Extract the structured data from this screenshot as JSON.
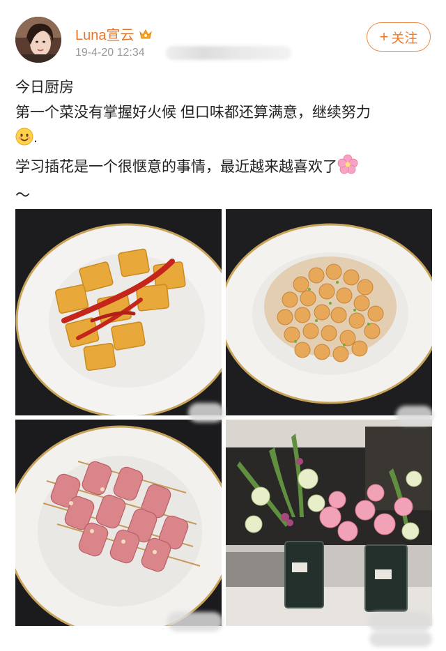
{
  "post": {
    "author": "Luna宣云",
    "timestamp": "19-4-20 12:34",
    "follow_label": "关注",
    "follow_plus": "+",
    "text_lines": [
      "今日厨房",
      "第一个菜没有掌握好火候 但口味都还算满意，继续努力",
      ".",
      "学习插花是一个很惬意的事情，最近越来越喜欢了",
      "～"
    ]
  },
  "photos": [
    {
      "subject": "omelette-roll-with-ketchup"
    },
    {
      "subject": "garlic-shrimp"
    },
    {
      "subject": "bacon-enoki-skewers"
    },
    {
      "subject": "flower-arrangements"
    }
  ],
  "colors": {
    "username": "#e8752a",
    "follow_accent": "#ee7a2c",
    "timestamp": "#9a9a9a",
    "text": "#222222"
  },
  "icons": [
    "vip-crown-icon",
    "smile-emoji-icon",
    "cherry-blossom-emoji-icon",
    "plus-icon"
  ]
}
